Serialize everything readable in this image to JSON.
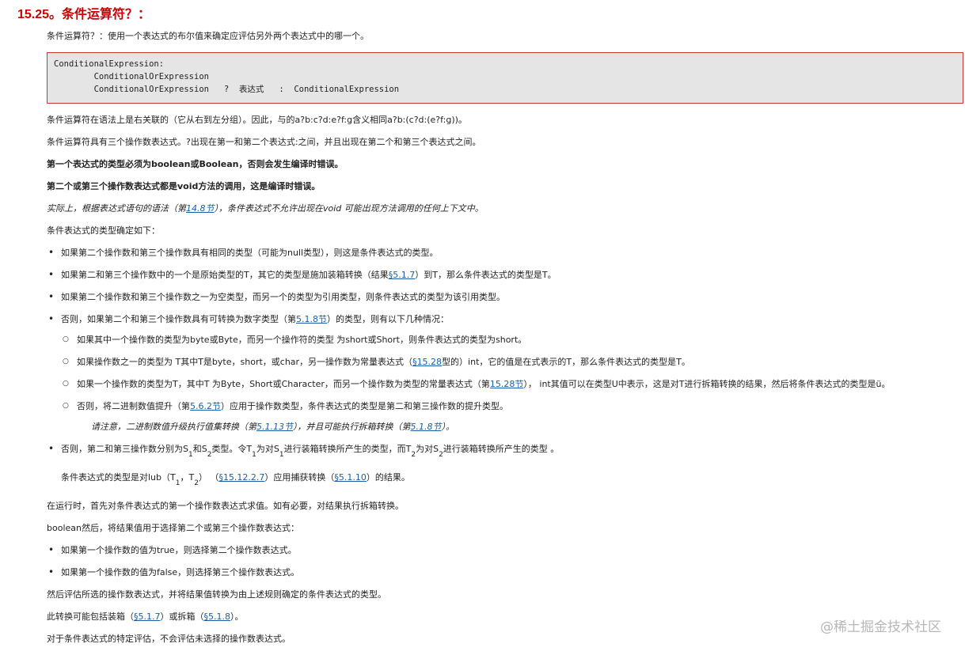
{
  "title": "15.25。条件运算符？：",
  "intro": "条件运算符？：使用一个表达式的布尔值来确定应评估另外两个表达式中的哪一个。",
  "code": {
    "line1": "ConditionalExpression:",
    "line2": "        ConditionalOrExpression",
    "line3": "        ConditionalOrExpression   ?  表达式   :  ConditionalExpression"
  },
  "p_assoc": "条件运算符在语法上是右关联的（它从右到左分组）。因此，与的a?b:c?d:e?f:g含义相同a?b:(c?d:(e?f:g))。",
  "p_three": "条件运算符具有三个操作数表达式。?出现在第一和第二个表达式:之间，并且出现在第二个和第三个表达式之间。",
  "p_bold1": "第一个表达式的类型必须为boolean或Boolean，否则会发生编译时错误。",
  "p_bold2": "第二个或第三个操作数表达式都是void方法的调用，这是编译时错误。",
  "p_italic": {
    "pre": "实际上，根据表达式语句的语法（第",
    "link": "14.8节",
    "post": "），条件表达式不允许出现在void 可能出现方法调用的任何上下文中。"
  },
  "p_type": "条件表达式的类型确定如下：",
  "b1": "如果第二个操作数和第三个操作数具有相同的类型（可能为null类型），则这是条件表达式的类型。",
  "b2": {
    "pre": "如果第二和第三个操作数中的一个是原始类型的T，其它的类型是施加装箱转换（结果",
    "link": "§5.1.7",
    "post": "）到T，那么条件表达式的类型是T。"
  },
  "b3": "如果第二个操作数和第三个操作数之一为空类型，而另一个的类型为引用类型，则条件表达式的类型为该引用类型。",
  "b4": {
    "pre": "否则，如果第二个和第三个操作数具有可转换为数字类型（第",
    "link": "5.1.8节",
    "post": "）的类型，则有以下几种情况："
  },
  "c1": "如果其中一个操作数的类型为byte或Byte，而另一个操作符的类型 为short或Short，则条件表达式的类型为short。",
  "c2": {
    "pre": "如果操作数之一的类型为 T其中T是byte，short，或char，另一操作数为常量表达式（",
    "link": "§15.28",
    "post": "型的）int，它的值是在式表示的T，那么条件表达式的类型是T。"
  },
  "c3": {
    "pre": "如果一个操作数的类型为T，其中T 为Byte，Short或Character，而另一个操作数为类型的常量表达式（第",
    "link": "15.28节",
    "post": "）， int其值可以在类型U中表示，这是对T进行拆箱转换的结果，然后将条件表达式的类型是ü。"
  },
  "c4": {
    "pre": "否则，将二进制数值提升（第",
    "link": "5.6.2节",
    "post": "）应用于操作数类型，条件表达式的类型是第二和第三操作数的提升类型。"
  },
  "note": {
    "pre": "请注意，二进制数值升级执行值集转换（第",
    "link1": "5.1.13节",
    "mid": "），并且可能执行拆箱转换（第",
    "link2": "5.1.8节",
    "post": "）。"
  },
  "b5": {
    "t1": "否则，第二和第三操作数分别为S",
    "s1": "1",
    "t2": "和S",
    "s2": "2",
    "t3": "类型。令T",
    "s3": "1",
    "t4": "为对S",
    "s4": "1",
    "t5": "进行装箱转换所产生的类型，而T",
    "s5": "2",
    "t6": "为对S",
    "s6": "2",
    "t7": "进行装箱转换所产生的类型 。"
  },
  "lub": {
    "t1": "条件表达式的类型是对lub（T",
    "s1": "1",
    "t2": "，T",
    "s2": "2",
    "t3": "） （",
    "link1": "§15.12.2.7",
    "t4": "）应用捕获转换（",
    "link2": "§5.1.10",
    "t5": "）的结果。"
  },
  "p_runtime": "在运行时，首先对条件表达式的第一个操作数表达式求值。如有必要，对结果执行拆箱转换。",
  "p_boolean": "boolean然后，将结果值用于选择第二个或第三个操作数表达式：",
  "d1": "如果第一个操作数的值为true，则选择第二个操作数表达式。",
  "d2": "如果第一个操作数的值为false，则选择第三个操作数表达式。",
  "p_then": "然后评估所选的操作数表达式，并将结果值转换为由上述规则确定的条件表达式的类型。",
  "p_conv": {
    "pre": "此转换可能包括装箱（",
    "link1": "§5.1.7",
    "mid": "）或拆箱（",
    "link2": "§5.1.8",
    "post": "）。"
  },
  "p_last": "对于条件表达式的特定评估，不会评估未选择的操作数表达式。",
  "watermark": "@稀土掘金技术社区"
}
